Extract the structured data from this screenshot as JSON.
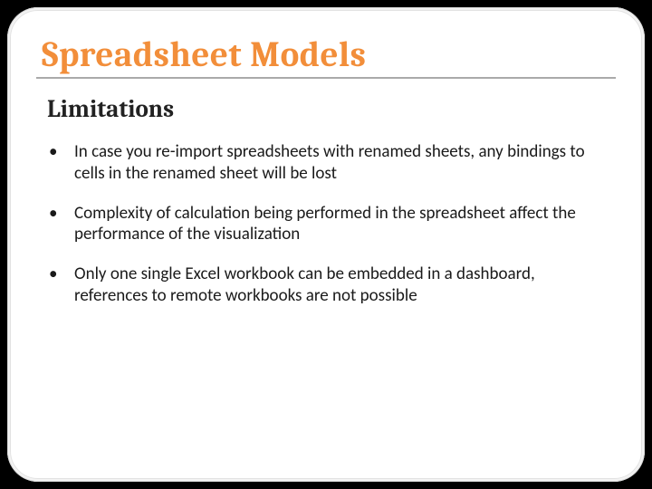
{
  "title": "Spreadsheet Models",
  "subtitle": "Limitations",
  "bullets": [
    {
      "mark": "•",
      "text": " In case you re-import spreadsheets with renamed sheets, any bindings to cells in the renamed sheet will be lost"
    },
    {
      "mark": "•",
      "text": " Complexity of calculation being performed in the spreadsheet affect the performance of the visualization"
    },
    {
      "mark": "•",
      "text": " Only one single Excel workbook can be embedded in a dashboard, references to remote workbooks are not possible"
    }
  ]
}
